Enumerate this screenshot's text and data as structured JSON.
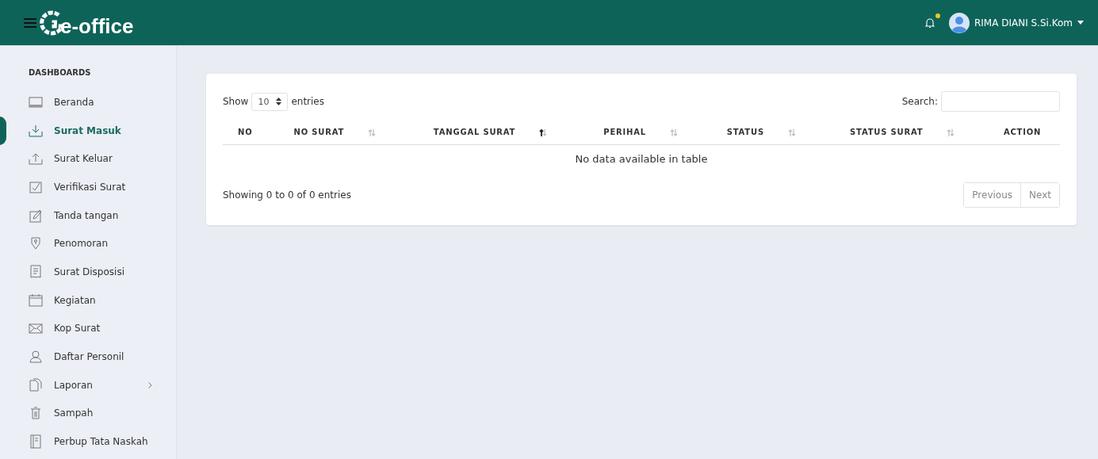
{
  "header": {
    "logo_text": "e-office",
    "notification": {
      "unread": true
    },
    "user": {
      "name": "RIMA DIANI S.Si.Kom"
    }
  },
  "sidebar": {
    "section_title": "DASHBOARDS",
    "items": [
      {
        "label": "Beranda",
        "selected": false,
        "submenu": false
      },
      {
        "label": "Surat Masuk",
        "selected": true,
        "submenu": false
      },
      {
        "label": "Surat Keluar",
        "selected": false,
        "submenu": false
      },
      {
        "label": "Verifikasi Surat",
        "selected": false,
        "submenu": false
      },
      {
        "label": "Tanda tangan",
        "selected": false,
        "submenu": false
      },
      {
        "label": "Penomoran",
        "selected": false,
        "submenu": false
      },
      {
        "label": "Surat Disposisi",
        "selected": false,
        "submenu": false
      },
      {
        "label": "Kegiatan",
        "selected": false,
        "submenu": false
      },
      {
        "label": "Kop Surat",
        "selected": false,
        "submenu": false
      },
      {
        "label": "Daftar Personil",
        "selected": false,
        "submenu": false
      },
      {
        "label": "Laporan",
        "selected": false,
        "submenu": true
      },
      {
        "label": "Sampah",
        "selected": false,
        "submenu": false
      },
      {
        "label": "Perbup Tata Naskah",
        "selected": false,
        "submenu": false
      }
    ]
  },
  "table_card": {
    "length": {
      "before": "Show",
      "value": "10",
      "after": "entries"
    },
    "search": {
      "label": "Search:"
    },
    "columns": [
      {
        "label": "NO",
        "sortable": false
      },
      {
        "label": "NO SURAT",
        "sortable": true,
        "sorted_ascending": false
      },
      {
        "label": "TANGGAL SURAT",
        "sortable": true,
        "sorted_ascending": true
      },
      {
        "label": "PERIHAL",
        "sortable": true,
        "sorted_ascending": false
      },
      {
        "label": "STATUS",
        "sortable": true,
        "sorted_ascending": false
      },
      {
        "label": "STATUS SURAT",
        "sortable": true,
        "sorted_ascending": false
      },
      {
        "label": "ACTION",
        "sortable": false
      }
    ],
    "empty_message": "No data available in table",
    "info": "Showing 0 to 0 of 0 entries",
    "pagination": [
      {
        "label": "Previous",
        "disabled": true
      },
      {
        "label": "Next",
        "disabled": true
      }
    ]
  }
}
